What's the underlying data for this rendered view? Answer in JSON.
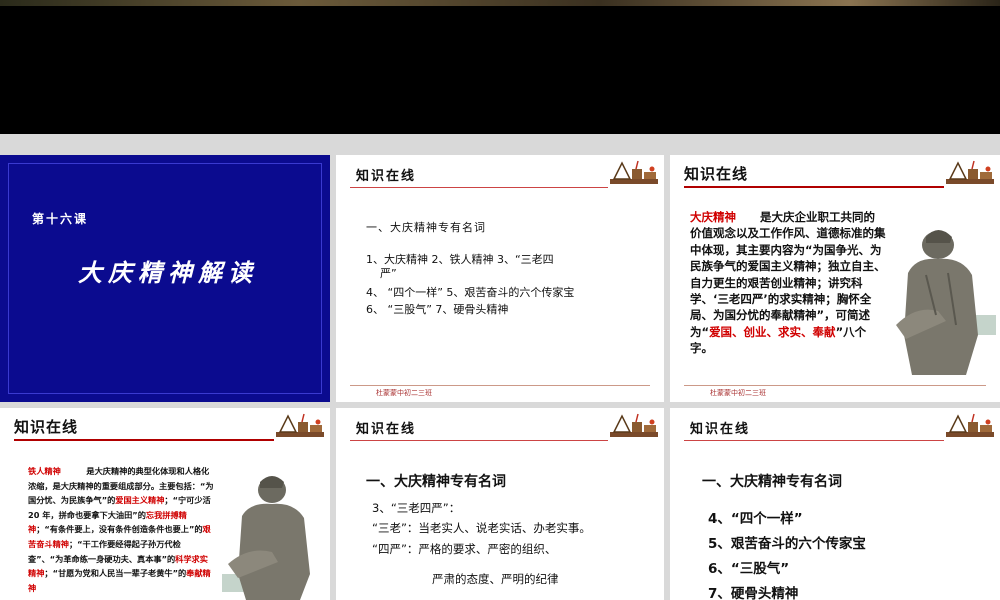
{
  "slides": {
    "s1": {
      "lesson": "第十六课",
      "title": "大庆精神解读"
    },
    "s2": {
      "header": "知识在线",
      "section": "一、大庆精神专有名词",
      "lines": [
        "1、大庆精神    2、铁人精神    3、“三老四",
        "严”",
        "4、 “四个一样”      5、艰苦奋斗的六个传家宝",
        "6、 “三股气”       7、硬骨头精神"
      ],
      "footer": "杜蒙蒙中初二三班"
    },
    "s3": {
      "header": "知识在线",
      "term": "大庆精神",
      "text_a": "是大庆企业职工共同的价值观念以及工作作风、道德标准的集中体现，其主要内容为“为国争光、为民族争气的爱国主义精神；独立自主、自力更生的艰苦创业精神；讲究科学、‘三老四严’的求实精神；胸怀全局、为国分忧的奉献精神”，可简述为“",
      "text_red": "爱国、创业、求实、奉献",
      "text_b": "”八个字。",
      "footer": "杜蒙蒙中初二三班"
    },
    "s4": {
      "header": "知识在线",
      "term": "铁人精神",
      "t1": "是大庆精神的典型化体现和人格化浓缩，是大庆精神的重要组成部分。主要包括：“为国分忧、为民族争气”的",
      "r1": "爱国主义精神",
      "t2": "；“宁可少活 20 年，拼命也要拿下大油田”的",
      "r2": "忘我拼搏精神",
      "t3": "；“有条件要上，没有条件创造条件也要上”的",
      "r3": "艰苦奋斗精神",
      "t4": "；“干工作要经得起子孙万代检查”、“为革命练一身硬功夫、真本事”的",
      "r4": "科学求实精神",
      "t5": "；“甘愿为党和人民当一辈子老黄牛”的",
      "r5": "奉献精神"
    },
    "s5": {
      "header": "知识在线",
      "section": "一、大庆精神专有名词",
      "item": "3、“三老四严”：",
      "sanlao": "“三老”：当老实人、说老实话、办老实事。",
      "siyan": "“四严”：严格的要求、严密的组织、",
      "siyan2": "严肃的态度、严明的纪律"
    },
    "s6": {
      "header": "知识在线",
      "section": "一、大庆精神专有名词",
      "items": [
        "4、“四个一样”",
        "5、艰苦奋斗的六个传家宝",
        "6、“三股气”",
        "7、硬骨头精神"
      ]
    }
  }
}
